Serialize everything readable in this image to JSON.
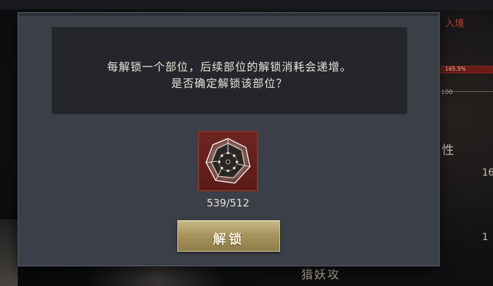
{
  "background": {
    "top_title": "",
    "side_red_text": "入境",
    "bar_text": "165.5%",
    "small_number": "100",
    "side_char": "性",
    "side_num1": "16",
    "side_num2": "1",
    "bottom_text": "猎妖攻"
  },
  "dialog": {
    "message_line1": "每解锁一个部位，后续部位的解锁消耗会递增。",
    "message_line2": "是否确定解锁该部位？",
    "item": {
      "icon": "crystal-gem-icon",
      "count": "539/512"
    },
    "unlock_button_label": "解锁"
  },
  "colors": {
    "dialog_bg": "#3b3f47",
    "panel_bg": "#24262b",
    "slot_bg": "#6d2420",
    "button_gold": "#a8955e"
  }
}
